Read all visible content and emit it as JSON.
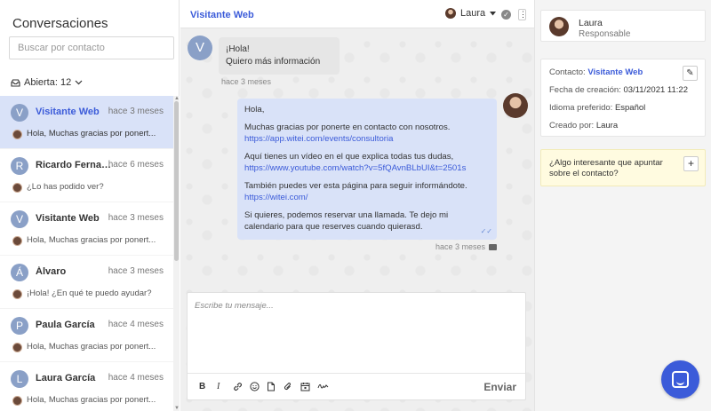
{
  "left": {
    "title": "Conversaciones",
    "search_placeholder": "Buscar por contacto",
    "filter_label": "Abierta: 12"
  },
  "conversations": [
    {
      "initial": "V",
      "name": "Visitante Web",
      "time": "hace 3 meses",
      "preview": "Hola, Muchas gracias por ponert...",
      "active": true
    },
    {
      "initial": "R",
      "name": "Ricardo Fernand...",
      "time": "hace 6 meses",
      "preview": "¿Lo has podido ver?"
    },
    {
      "initial": "V",
      "name": "Visitante Web",
      "time": "hace 3 meses",
      "preview": "Hola, Muchas gracias por ponert..."
    },
    {
      "initial": "Á",
      "name": "Álvaro",
      "time": "hace 3 meses",
      "preview": "¡Hola! ¿En qué te puedo ayudar?"
    },
    {
      "initial": "P",
      "name": "Paula García",
      "time": "hace 4 meses",
      "preview": "Hola, Muchas gracias por ponert..."
    },
    {
      "initial": "L",
      "name": "Laura García",
      "time": "hace 4 meses",
      "preview": "Hola, Muchas gracias por ponert..."
    }
  ],
  "chat": {
    "contact_name": "Visitante Web",
    "agent_name": "Laura",
    "incoming": {
      "initial": "V",
      "line1": "¡Hola!",
      "line2": "Quiero más información",
      "time": "hace 3 meses"
    },
    "outgoing": {
      "p1": "Hola,",
      "p2": "Muchas gracias por ponerte en contacto con nosotros.",
      "link1": "https://app.witei.com/events/consultoria",
      "p3": "Aquí tienes un vídeo en el que explica todas tus dudas,",
      "link2": "https://www.youtube.com/watch?v=5fQAvnBLbUI&t=2501s",
      "p4": "También puedes ver esta página para seguir informándote.",
      "link3": "https://witei.com/",
      "p5": "Si quieres, podemos reservar una llamada. Te dejo mi calendario para que reserves cuando quierasd.",
      "time": "hace 3 meses"
    },
    "composer_placeholder": "Escribe tu mensaje...",
    "send_label": "Enviar",
    "toolbar": {
      "bold": "B",
      "italic": "I"
    }
  },
  "right": {
    "agent_name": "Laura",
    "agent_role": "Responsable",
    "contact_label": "Contacto:",
    "contact_value": "Visitante Web",
    "created_label": "Fecha de creación:",
    "created_value": "03/11/2021 11:22",
    "language_label": "Idioma preferido:",
    "language_value": "Español",
    "creator_label": "Creado por:",
    "creator_value": "Laura",
    "note_prompt": "¿Algo interesante que apuntar sobre el contacto?"
  },
  "colors": {
    "accent": "#3b5bd9",
    "active_bg": "#d9e2f8",
    "note_bg": "#fffbe0"
  }
}
